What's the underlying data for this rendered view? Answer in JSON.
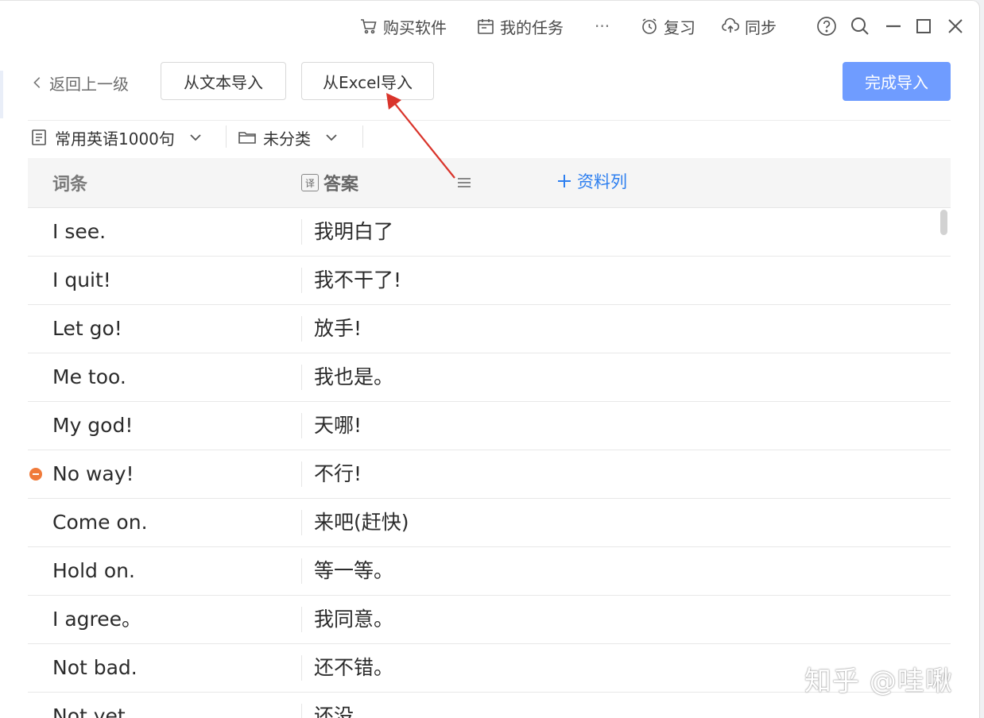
{
  "titlebar": {
    "buy": "购买软件",
    "tasks": "我的任务",
    "more": "···",
    "review": "复习",
    "sync": "同步"
  },
  "toolbar": {
    "back": "返回上一级",
    "import_text": "从文本导入",
    "import_excel": "从Excel导入",
    "finish": "完成导入"
  },
  "selectors": {
    "deck": "常用英语1000句",
    "category": "未分类"
  },
  "table": {
    "col_term": "词条",
    "col_answer": "答案",
    "col_answer_badge": "译",
    "add_column": "资料列",
    "rows": [
      {
        "term": "I see.",
        "answer": "我明白了"
      },
      {
        "term": "I quit!",
        "answer": "我不干了!"
      },
      {
        "term": "Let go!",
        "answer": "放手!"
      },
      {
        "term": "Me too.",
        "answer": "我也是。"
      },
      {
        "term": "My god!",
        "answer": "天哪!"
      },
      {
        "term": "No way!",
        "answer": "不行!"
      },
      {
        "term": "Come on.",
        "answer": "来吧(赶快)"
      },
      {
        "term": "Hold on.",
        "answer": "等一等。"
      },
      {
        "term": "I agree。",
        "answer": "我同意。"
      },
      {
        "term": "Not bad.",
        "answer": "还不错。"
      },
      {
        "term": "Not yet.",
        "answer": "还没。"
      }
    ]
  },
  "watermark": "知乎 @哇啾",
  "colors": {
    "primary": "#6f9cff",
    "link": "#2d7ff0",
    "flag": "#f07a3a",
    "annotation_arrow": "#d9342b"
  }
}
